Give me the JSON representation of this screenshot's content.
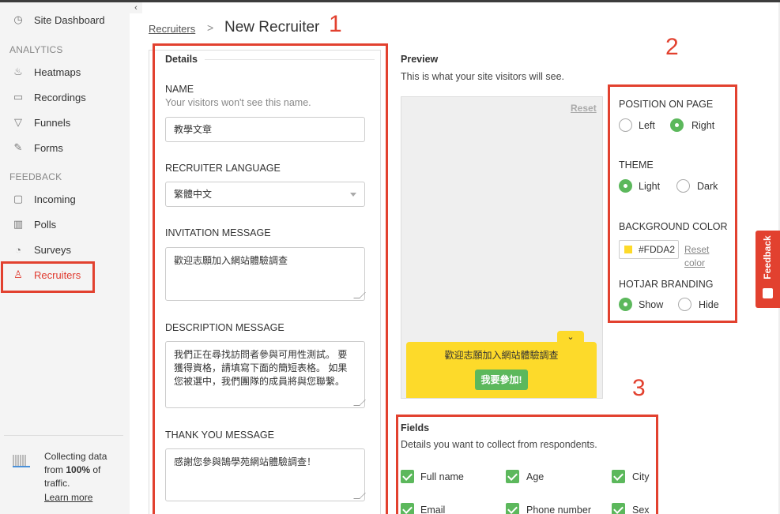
{
  "sidebar": {
    "items": [
      {
        "label": "Site Dashboard",
        "icon": "dashboard-icon"
      },
      {
        "label": "Heatmaps",
        "icon": "flame-icon"
      },
      {
        "label": "Recordings",
        "icon": "camera-icon"
      },
      {
        "label": "Funnels",
        "icon": "funnel-icon"
      },
      {
        "label": "Forms",
        "icon": "form-icon"
      },
      {
        "label": "Incoming",
        "icon": "inbox-icon"
      },
      {
        "label": "Polls",
        "icon": "bar-chart-icon"
      },
      {
        "label": "Surveys",
        "icon": "pie-chart-icon"
      },
      {
        "label": "Recruiters",
        "icon": "recruiter-icon"
      }
    ],
    "sections": {
      "analytics": "ANALYTICS",
      "feedback": "FEEDBACK"
    },
    "collecting": {
      "prefix": "Collecting data from ",
      "percent": "100%",
      "suffix": " of traffic.",
      "learn_more": "Learn more"
    }
  },
  "breadcrumb": {
    "parent": "Recruiters",
    "separator": ">",
    "title": "New Recruiter"
  },
  "annotations": {
    "one": "1",
    "two": "2",
    "three": "3"
  },
  "details": {
    "heading": "Details",
    "name_label": "NAME",
    "name_sub": "Your visitors won't see this name.",
    "name_value": "教學文章",
    "language_label": "RECRUITER LANGUAGE",
    "language_value": "繁體中文",
    "invitation_label": "INVITATION MESSAGE",
    "invitation_value": "歡迎志願加入網站體驗調查",
    "description_label": "DESCRIPTION MESSAGE",
    "description_value": "我們正在尋找訪問者參與可用性測試。 要獲得資格，請填寫下面的簡短表格。 如果您被選中，我們團隊的成員將與您聯繫。",
    "thanks_label": "THANK YOU MESSAGE",
    "thanks_value": "感謝您參與鵠學苑網站體驗調查！"
  },
  "preview": {
    "title": "Preview",
    "subtitle": "This is what your site visitors will see.",
    "reset": "Reset",
    "widget_message": "歡迎志願加入網站體驗調查",
    "widget_button": "我要參加!",
    "widget_tab": "⌄"
  },
  "options": {
    "position_label": "POSITION ON PAGE",
    "position_left": "Left",
    "position_right": "Right",
    "theme_label": "THEME",
    "theme_light": "Light",
    "theme_dark": "Dark",
    "bg_label": "BACKGROUND COLOR",
    "bg_value": "#FDDA2",
    "bg_reset": "Reset color",
    "branding_label": "HOTJAR BRANDING",
    "branding_show": "Show",
    "branding_hide": "Hide"
  },
  "fields": {
    "title": "Fields",
    "subtitle": "Details you want to collect from respondents.",
    "items": [
      "Full name",
      "Age",
      "City",
      "Email",
      "Phone number",
      "Sex"
    ]
  },
  "feedback_tab": "Feedback",
  "colors": {
    "accent": "#e2412f",
    "green": "#5cb85c",
    "yellow": "#fdda2a"
  }
}
